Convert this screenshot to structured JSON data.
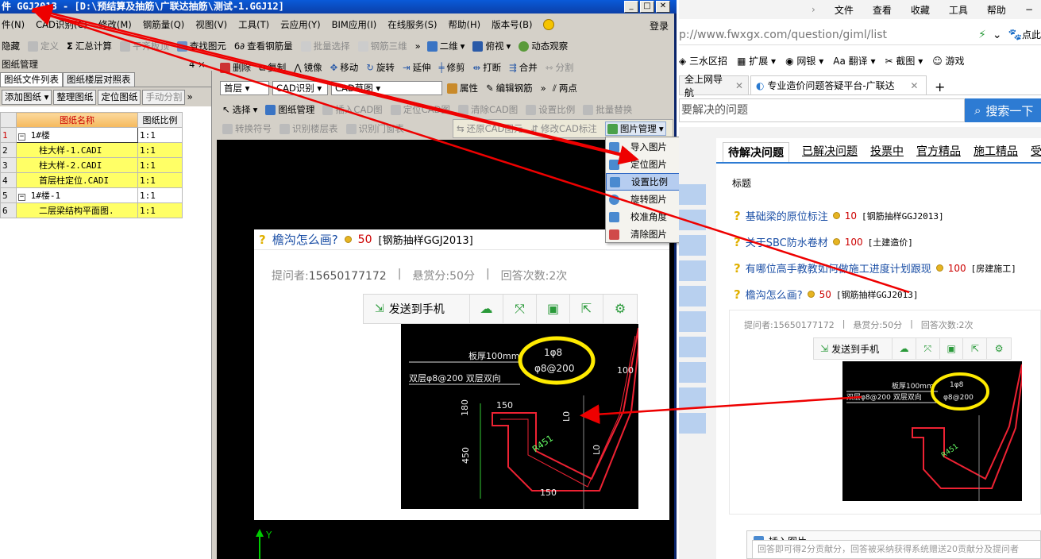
{
  "app": {
    "title": "件 GGJ2013 - [D:\\预结算及抽筋\\广联达抽筋\\测试-1.GGJ12]",
    "menu": [
      "件(N)",
      "CAD识别(C)",
      "修改(M)",
      "钢筋量(Q)",
      "视图(V)",
      "工具(T)",
      "云应用(Y)",
      "BIM应用(I)",
      "在线服务(S)",
      "帮助(H)",
      "版本号(B)"
    ],
    "login": "登录",
    "toolbar1": [
      "隐藏",
      "定义",
      "汇总计算",
      "平齐板顶",
      "查找图元",
      "查看钢筋量",
      "批量选择",
      "钢筋三维",
      "二维",
      "俯视",
      "动态观察"
    ],
    "toolbar2": [
      "删除",
      "复制",
      "镜像",
      "移动",
      "旋转",
      "延伸",
      "修剪",
      "打断",
      "合并",
      "分割"
    ],
    "toolbar3": {
      "floor": "首层",
      "cad": "CAD识别",
      "draft": "CAD草图",
      "prop": "属性",
      "edit": "编辑钢筋",
      "twopoint": "两点"
    },
    "toolbar4": [
      "选择",
      "图纸管理",
      "插入CAD图",
      "定位CAD图",
      "清除CAD图",
      "设置比例",
      "批量替换"
    ],
    "toolbar5": [
      "转换符号",
      "识别楼层表",
      "识别门窗表",
      "还原CAD图元",
      "修改CAD标注",
      "图片管理"
    ],
    "panel": {
      "title": "图纸管理",
      "pin": "4 ×",
      "tabs": [
        "图纸文件列表",
        "图纸楼层对照表"
      ],
      "buttons": [
        "添加图纸",
        "整理图纸",
        "定位图纸",
        "手动分割"
      ],
      "columns": [
        "图纸名称",
        "图纸比例"
      ],
      "rows": [
        [
          "1",
          "1#楼",
          "1:1"
        ],
        [
          "2",
          "柱大样-1.CADI",
          "1:1"
        ],
        [
          "3",
          "柱大样-2.CADI",
          "1:1"
        ],
        [
          "4",
          "首层柱定位.CADI",
          "1:1"
        ],
        [
          "5",
          "1#楼-1",
          "1:1"
        ],
        [
          "6",
          "二层梁结构平面图.",
          "1:1"
        ]
      ]
    },
    "dropdown": [
      "导入图片",
      "定位图片",
      "设置比例",
      "旋转图片",
      "校准角度",
      "清除图片"
    ],
    "axis_y": "Y"
  },
  "question": {
    "title": "檐沟怎么画?",
    "points": "50",
    "category": "[钢筋抽样GGJ2013]",
    "asker_label": "提问者:",
    "asker": "15650177172",
    "reward": "悬赏分:50分",
    "answers": "回答次数:2次",
    "send": "发送到手机",
    "drawing": {
      "thick": "板厚100mm",
      "rebar1": "1φ8",
      "rebar2": "φ8@200",
      "dist": "双层φ8@200 双层双向",
      "n150": "150",
      "n100": "100",
      "n180": "180",
      "n450": "450",
      "r": "R451",
      "l1": "L0",
      "l2": "L0",
      "n150b": "150"
    }
  },
  "browser": {
    "menu": [
      "文件",
      "查看",
      "收藏",
      "工具",
      "帮助"
    ],
    "url_host": "p://www.fwxgx.com",
    "url_path": "/question/giml/list",
    "favs": [
      "三水区招",
      "扩展",
      "网银",
      "翻译",
      "截图",
      "游戏"
    ],
    "tabs": [
      "全上网导航",
      "专业造价问题答疑平台-广联达"
    ],
    "search_placeholder": "要解决的问题",
    "search_btn": "搜索一下",
    "nav": [
      "待解决问题",
      "已解决问题",
      "投票中",
      "官方精品",
      "施工精品",
      "受"
    ],
    "col_title": "标题",
    "items": [
      {
        "t": "基础梁的原位标注",
        "p": "10",
        "c": "[钢筋抽样GGJ2013]"
      },
      {
        "t": "关于SBC防水卷材",
        "p": "100",
        "c": "[土建造价]"
      },
      {
        "t": "有哪位高手教教如何做施工进度计划跟现",
        "p": "100",
        "c": "[房建施工]"
      },
      {
        "t": "檐沟怎么画?",
        "p": "50",
        "c": "[钢筋抽样GGJ2013]"
      }
    ],
    "detail": {
      "asker": "提问者:15650177172",
      "reward": "悬赏分:50分",
      "answers": "回答次数:2次",
      "send": "发送到手机"
    },
    "insert": "插入图片",
    "hint": "回答即可得2分贡献分，回答被采纳获得系统赠送20贡献分及提问者"
  },
  "colors": {
    "arrow": "#e00000",
    "highlight": "#ffff66",
    "titlebar": "#0a46c0"
  }
}
